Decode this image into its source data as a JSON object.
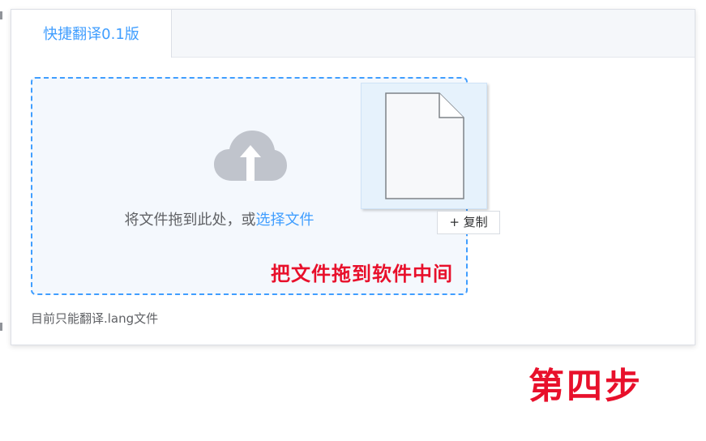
{
  "tabs": [
    {
      "label": "快捷翻译0.1版",
      "active": true
    }
  ],
  "upload": {
    "prompt": "将文件拖到此处，或",
    "select_link": "选择文件",
    "annotation": "把文件拖到软件中间",
    "hint": "目前只能翻译.lang文件",
    "cloud_icon": "cloud-upload-icon",
    "accent_color": "#409eff"
  },
  "drag": {
    "file_icon": "file-icon",
    "copy_tip": "+ 复制"
  },
  "step_label": "第四步",
  "annotation_color": "#e8102b"
}
